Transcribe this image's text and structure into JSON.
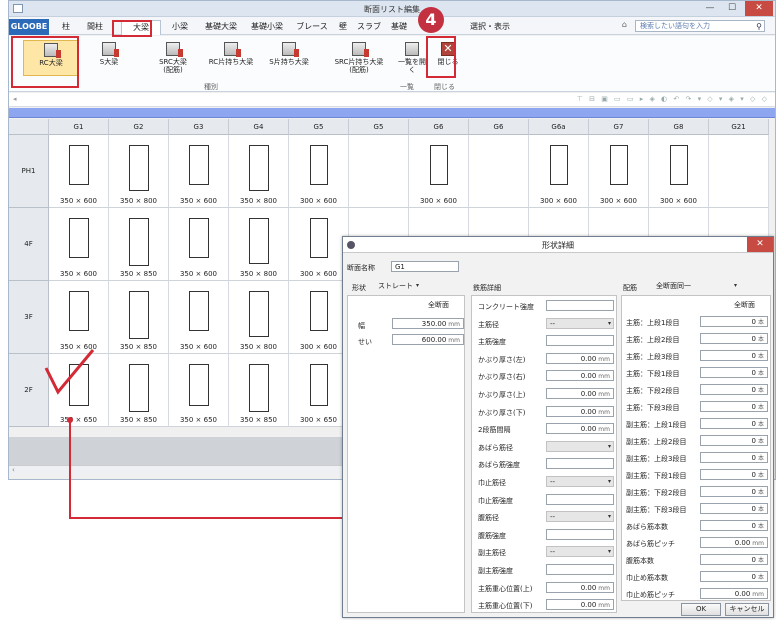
{
  "window": {
    "title": "断面リスト編集"
  },
  "tabs": [
    "GLOOBE",
    "柱",
    "間柱",
    "大梁",
    "小梁",
    "基礎大梁",
    "基礎小梁",
    "ブレース",
    "壁",
    "スラブ",
    "基礎",
    "選択・表示"
  ],
  "search": {
    "placeholder": "検索したい語句を入力"
  },
  "ribbon": {
    "buttons": [
      {
        "label": "RC大梁"
      },
      {
        "label": "S大梁"
      },
      {
        "label": "SRC大梁\n(配筋)"
      },
      {
        "label": "RC片持ち大梁"
      },
      {
        "label": "S片持ち大梁"
      },
      {
        "label": "SRC片持ち大梁\n(配筋)"
      },
      {
        "label": "一覧を開く"
      },
      {
        "label": "閉じる"
      }
    ],
    "groups": {
      "kind": "種別",
      "list": "一覧",
      "close": "閉じる"
    }
  },
  "step_badge": "4",
  "grid": {
    "columns": [
      "G1",
      "G2",
      "G3",
      "G4",
      "G5",
      "G5",
      "G6",
      "G6",
      "G6a",
      "G7",
      "G8",
      "G21"
    ],
    "rows": [
      {
        "name": "PH1",
        "dims": [
          "350 × 600",
          "350 × 800",
          "350 × 600",
          "350 × 800",
          "300 × 600",
          "",
          "300 × 600",
          "",
          "300 × 600",
          "300 × 600",
          "300 × 600",
          ""
        ]
      },
      {
        "name": "4F",
        "dims": [
          "350 × 600",
          "350 × 850",
          "350 × 600",
          "350 × 800",
          "300 × 600",
          "",
          "",
          "",
          "",
          "",
          "",
          ""
        ]
      },
      {
        "name": "3F",
        "dims": [
          "350 × 600",
          "350 × 850",
          "350 × 600",
          "350 × 800",
          "300 × 600",
          "",
          "",
          "",
          "",
          "",
          "",
          ""
        ]
      },
      {
        "name": "2F",
        "dims": [
          "350 × 650",
          "350 × 850",
          "350 × 650",
          "350 × 850",
          "300 × 650",
          "",
          "",
          "",
          "",
          "",
          "",
          ""
        ]
      }
    ]
  },
  "dialog": {
    "title": "形状詳細",
    "section_name_label": "断面名称",
    "section_name": "G1",
    "shape_label": "形状",
    "shape_value": "ストレート",
    "all_section": "全断面",
    "width_label": "幅",
    "width_value": "350.00",
    "height_label": "せい",
    "height_value": "600.00",
    "unit_mm": "mm",
    "rebar_title": "鉄筋詳細",
    "arrangement_label": "配筋",
    "arrangement_value": "全断面同一",
    "rebar_fields": [
      {
        "label": "コンクリート強度",
        "value": "",
        "type": "text"
      },
      {
        "label": "主筋径",
        "value": "--",
        "type": "select"
      },
      {
        "label": "主筋強度",
        "value": "",
        "type": "text"
      },
      {
        "label": "かぶり厚さ(左)",
        "value": "0.00",
        "type": "mm"
      },
      {
        "label": "かぶり厚さ(右)",
        "value": "0.00",
        "type": "mm"
      },
      {
        "label": "かぶり厚さ(上)",
        "value": "0.00",
        "type": "mm"
      },
      {
        "label": "かぶり厚さ(下)",
        "value": "0.00",
        "type": "mm"
      },
      {
        "label": "2段筋間隔",
        "value": "0.00",
        "type": "mm"
      },
      {
        "label": "あばら筋径",
        "value": "",
        "type": "select"
      },
      {
        "label": "あばら筋強度",
        "value": "",
        "type": "text"
      },
      {
        "label": "巾止筋径",
        "value": "--",
        "type": "select"
      },
      {
        "label": "巾止筋強度",
        "value": "",
        "type": "text"
      },
      {
        "label": "腹筋径",
        "value": "--",
        "type": "select"
      },
      {
        "label": "腹筋強度",
        "value": "",
        "type": "text"
      },
      {
        "label": "副主筋径",
        "value": "--",
        "type": "select"
      },
      {
        "label": "副主筋強度",
        "value": "",
        "type": "text"
      },
      {
        "label": "主筋重心位置(上)",
        "value": "0.00",
        "type": "mm"
      },
      {
        "label": "主筋重心位置(下)",
        "value": "0.00",
        "type": "mm"
      }
    ],
    "count_header": "全断面",
    "unit_count": "本",
    "count_fields": [
      {
        "label": "主筋：上段1段目",
        "value": "0",
        "type": "count"
      },
      {
        "label": "主筋：上段2段目",
        "value": "0",
        "type": "count"
      },
      {
        "label": "主筋：上段3段目",
        "value": "0",
        "type": "count"
      },
      {
        "label": "主筋：下段1段目",
        "value": "0",
        "type": "count"
      },
      {
        "label": "主筋：下段2段目",
        "value": "0",
        "type": "count"
      },
      {
        "label": "主筋：下段3段目",
        "value": "0",
        "type": "count"
      },
      {
        "label": "副主筋：上段1段目",
        "value": "0",
        "type": "count"
      },
      {
        "label": "副主筋：上段2段目",
        "value": "0",
        "type": "count"
      },
      {
        "label": "副主筋：上段3段目",
        "value": "0",
        "type": "count"
      },
      {
        "label": "副主筋：下段1段目",
        "value": "0",
        "type": "count"
      },
      {
        "label": "副主筋：下段2段目",
        "value": "0",
        "type": "count"
      },
      {
        "label": "副主筋：下段3段目",
        "value": "0",
        "type": "count"
      },
      {
        "label": "あばら筋本数",
        "value": "0",
        "type": "count"
      },
      {
        "label": "あばら筋ピッチ",
        "value": "0.00",
        "type": "mm"
      },
      {
        "label": "腹筋本数",
        "value": "0",
        "type": "count"
      },
      {
        "label": "巾止め筋本数",
        "value": "0",
        "type": "count"
      },
      {
        "label": "巾止め筋ピッチ",
        "value": "0.00",
        "type": "mm"
      }
    ],
    "ok_label": "OK",
    "cancel_label": "キャンセル"
  },
  "colors": {
    "accent_red": "#d42a35",
    "file_tab": "#2a6ab8",
    "band": "#8ea6f0",
    "selected": "#fde6a6"
  }
}
